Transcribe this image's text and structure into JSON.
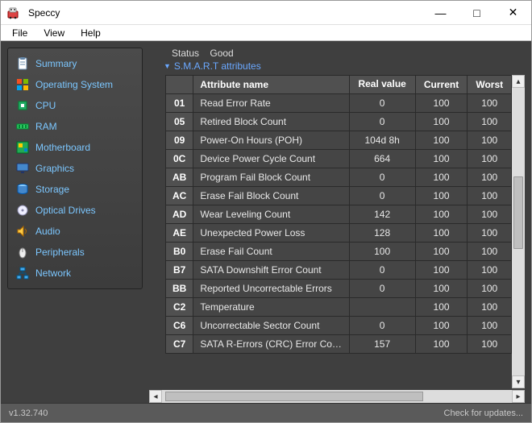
{
  "window": {
    "title": "Speccy"
  },
  "menus": {
    "file": "File",
    "view": "View",
    "help": "Help"
  },
  "sidebar": {
    "items": [
      {
        "label": "Summary"
      },
      {
        "label": "Operating System"
      },
      {
        "label": "CPU"
      },
      {
        "label": "RAM"
      },
      {
        "label": "Motherboard"
      },
      {
        "label": "Graphics"
      },
      {
        "label": "Storage"
      },
      {
        "label": "Optical Drives"
      },
      {
        "label": "Audio"
      },
      {
        "label": "Peripherals"
      },
      {
        "label": "Network"
      }
    ]
  },
  "main": {
    "status_label": "Status",
    "status_value": "Good",
    "section_title": "S.M.A.R.T attributes",
    "headers": {
      "id": "",
      "name": "Attribute name",
      "real": "Real value",
      "current": "Current",
      "worst": "Worst"
    },
    "rows": [
      {
        "id": "01",
        "name": "Read Error Rate",
        "real": "0",
        "current": "100",
        "worst": "100"
      },
      {
        "id": "05",
        "name": "Retired Block Count",
        "real": "0",
        "current": "100",
        "worst": "100"
      },
      {
        "id": "09",
        "name": "Power-On Hours (POH)",
        "real": "104d 8h",
        "current": "100",
        "worst": "100"
      },
      {
        "id": "0C",
        "name": "Device Power Cycle Count",
        "real": "664",
        "current": "100",
        "worst": "100"
      },
      {
        "id": "AB",
        "name": "Program Fail Block Count",
        "real": "0",
        "current": "100",
        "worst": "100"
      },
      {
        "id": "AC",
        "name": "Erase Fail Block Count",
        "real": "0",
        "current": "100",
        "worst": "100"
      },
      {
        "id": "AD",
        "name": "Wear Leveling Count",
        "real": "142",
        "current": "100",
        "worst": "100"
      },
      {
        "id": "AE",
        "name": "Unexpected Power Loss",
        "real": "128",
        "current": "100",
        "worst": "100"
      },
      {
        "id": "B0",
        "name": "Erase Fail Count",
        "real": "100",
        "current": "100",
        "worst": "100"
      },
      {
        "id": "B7",
        "name": "SATA Downshift Error Count",
        "real": "0",
        "current": "100",
        "worst": "100"
      },
      {
        "id": "BB",
        "name": "Reported Uncorrectable Errors",
        "real": "0",
        "current": "100",
        "worst": "100"
      },
      {
        "id": "C2",
        "name": "Temperature",
        "real": "",
        "current": "100",
        "worst": "100"
      },
      {
        "id": "C6",
        "name": "Uncorrectable Sector Count",
        "real": "0",
        "current": "100",
        "worst": "100"
      },
      {
        "id": "C7",
        "name": "SATA R-Errors (CRC) Error Count",
        "real": "157",
        "current": "100",
        "worst": "100"
      }
    ]
  },
  "statusbar": {
    "version": "v1.32.740",
    "update": "Check for updates..."
  }
}
